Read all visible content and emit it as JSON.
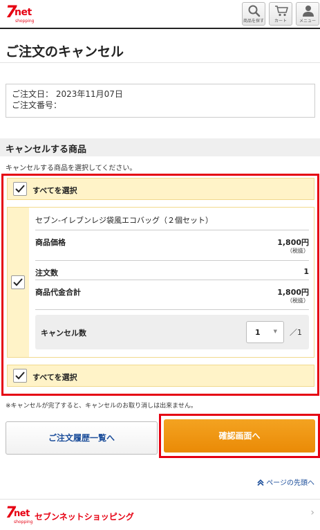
{
  "header": {
    "logo_seven": "7",
    "logo_net": "net",
    "logo_shopping": "shopping",
    "search_caption": "商品を探す",
    "cart_caption": "カート",
    "menu_caption": "メニュー"
  },
  "page": {
    "title": "ご注文のキャンセル"
  },
  "order": {
    "date_line": "ご注文日： 2023年11月07日",
    "number_line": "ご注文番号："
  },
  "section": {
    "heading": "キャンセルする商品",
    "note": "キャンセルする商品を選択してください。",
    "select_all_top": "すべてを選択",
    "select_all_bottom": "すべてを選択"
  },
  "item": {
    "name": "セブン-イレブンレジ袋風エコバッグ（２個セット）",
    "price_label": "商品価格",
    "price_value": "1,800円",
    "price_tax": "（税抜）",
    "qty_label": "注文数",
    "qty_value": "1",
    "total_label": "商品代金合計",
    "total_value": "1,800円",
    "total_tax": "（税抜）",
    "cancel_label": "キャンセル数",
    "cancel_value": "1",
    "cancel_arrow": "▼",
    "cancel_of": "／1"
  },
  "notes": {
    "warning": "※キャンセルが完了すると、キャンセルのお取り消しは出来ません。"
  },
  "buttons": {
    "history": "ご注文履歴一覧へ",
    "confirm": "確認画面へ"
  },
  "footer": {
    "page_top": "ページの先頭へ",
    "page_top_icon": "double-chevron-up-icon",
    "brand_name": "セブンネットショッピング",
    "chevron": "›"
  },
  "colors": {
    "brand_red": "#e60012",
    "highlight_red": "#e50012",
    "select_bg": "#fff3c8",
    "confirm_orange": "#ef9a14",
    "link_blue": "#1b4d9a"
  }
}
